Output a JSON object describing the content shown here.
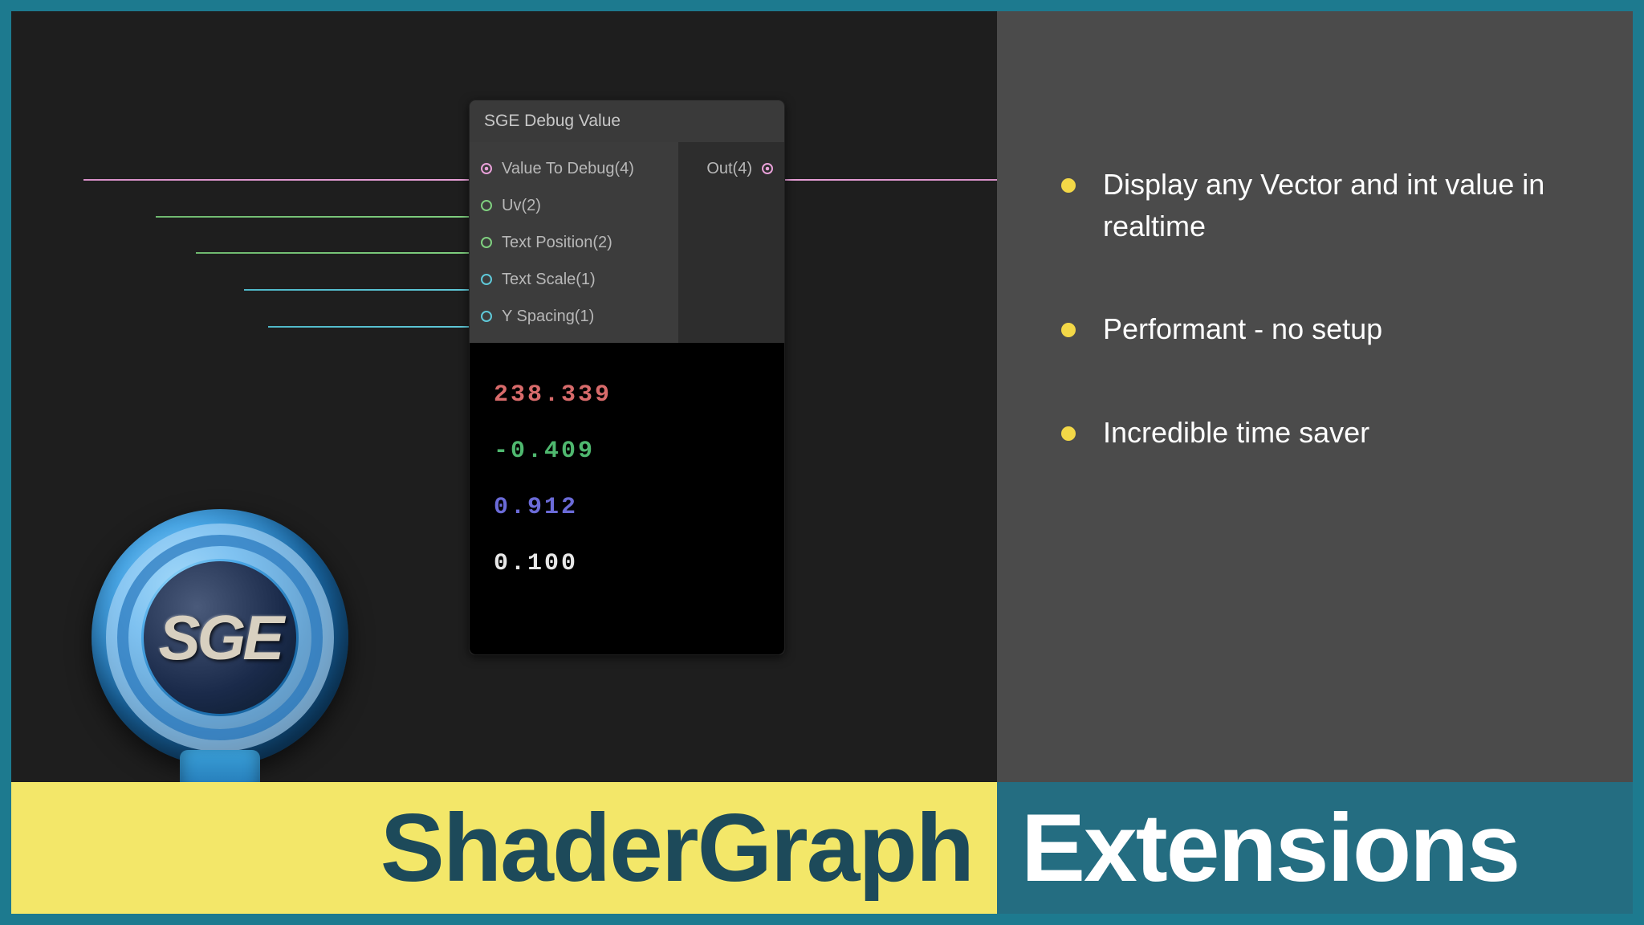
{
  "node": {
    "title": "SGE Debug Value",
    "inputs": [
      {
        "label": "Value To Debug(4)",
        "dot": "dot-pink"
      },
      {
        "label": "Uv(2)",
        "dot": "dot-green"
      },
      {
        "label": "Text Position(2)",
        "dot": "dot-green2"
      },
      {
        "label": "Text Scale(1)",
        "dot": "dot-cyan"
      },
      {
        "label": "Y Spacing(1)",
        "dot": "dot-cyan2"
      }
    ],
    "outputs": [
      {
        "label": "Out(4)",
        "dot": "dot-out"
      }
    ],
    "preview_values": [
      {
        "value": "238.339",
        "cls": "v-red"
      },
      {
        "value": "-0.409",
        "cls": "v-green"
      },
      {
        "value": "0.912",
        "cls": "v-blue"
      },
      {
        "value": "0.100",
        "cls": "v-white"
      }
    ]
  },
  "bullets": [
    "Display any Vector and int value in realtime",
    "Performant - no setup",
    "Incredible time saver"
  ],
  "logo_text": "SGE",
  "footer": {
    "left": "ShaderGraph",
    "right": "Extensions"
  }
}
